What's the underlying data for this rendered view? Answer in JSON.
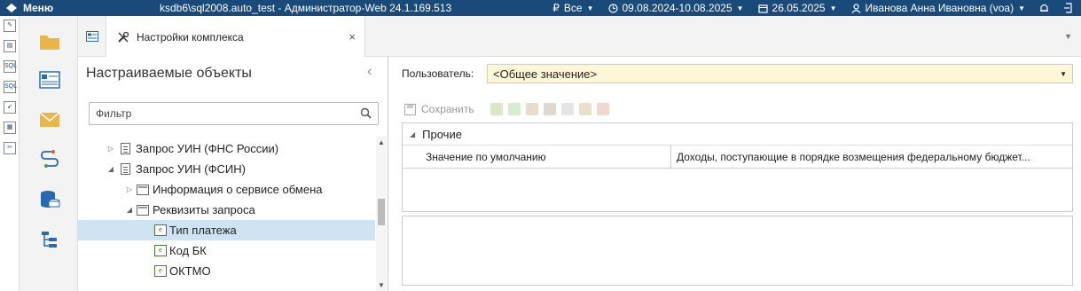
{
  "topbar": {
    "menu_label": "Меню",
    "title": "ksdb6\\sql2008.auto_test - Администратор-Web 24.1.169.513",
    "currency_symbol": "₽",
    "budget_filter": "Все",
    "period": "09.08.2024-10.08.2025",
    "date": "26.05.2025",
    "user": "Иванова Анна Ивановна (voa)"
  },
  "tabs": [
    {
      "label": "Настройки комплекса",
      "close": "×"
    }
  ],
  "left_panel": {
    "title": "Настраиваемые объекты",
    "collapse": "‹",
    "filter_placeholder": "Фильтр",
    "tree": [
      {
        "label": "Запрос УИН (ФНС России)",
        "arrow": "▷"
      },
      {
        "label": "Запрос УИН (ФСИН)",
        "arrow": "◢"
      },
      {
        "label": "Информация о сервисе обмена",
        "arrow": "▷"
      },
      {
        "label": "Реквизиты запроса",
        "arrow": "◢"
      },
      {
        "label": "Тип платежа",
        "arrow": ""
      },
      {
        "label": "Код БК",
        "arrow": ""
      },
      {
        "label": "ОКТМО",
        "arrow": ""
      }
    ]
  },
  "right_panel": {
    "user_label": "Пользователь:",
    "user_value": "<Общее значение>",
    "save_label": "Сохранить",
    "group": "Прочие",
    "property_name": "Значение по умолчанию",
    "property_value": "Доходы, поступающие в порядке возмещения федеральному бюджет..."
  },
  "colors": {
    "topbar": "#1a4a7a",
    "selected_row": "#cfe3f3",
    "select_bg": "#fdf7d8"
  }
}
